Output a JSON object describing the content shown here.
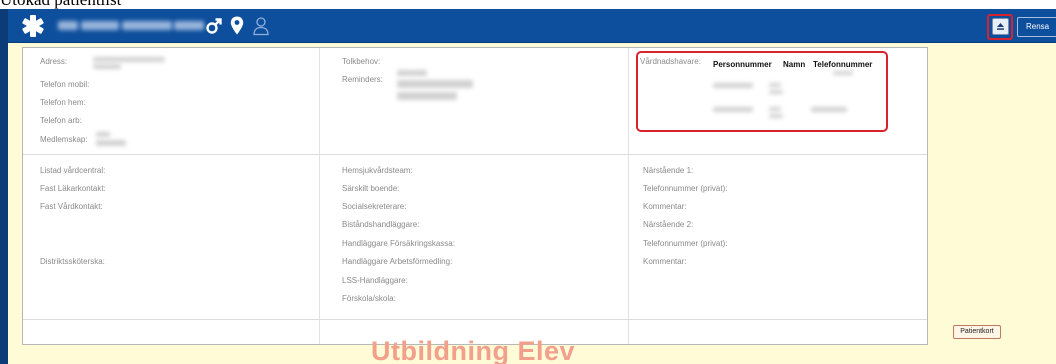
{
  "page": {
    "caption": "Utökad patientlist"
  },
  "header": {
    "patient_name_label": "",
    "collapse_icon": "eject-icon",
    "rensa_label": "Rensa",
    "icons": [
      "star-of-life-icon",
      "male-icon",
      "location-pin-icon",
      "person-icon"
    ]
  },
  "contact": {
    "adress_label": "Adress:",
    "telefon_mobil_label": "Telefon mobil:",
    "telefon_hem_label": "Telefon hem:",
    "telefon_arb_label": "Telefon arb:",
    "medlemskap_label": "Medlemskap:"
  },
  "needs": {
    "tolkbehov_label": "Tolkbehov:",
    "reminders_label": "Reminders:"
  },
  "guardian": {
    "label": "Vårdnadshavare:",
    "columns": [
      "Personnummer",
      "Namn",
      "Telefonnummer"
    ]
  },
  "care": {
    "col1": {
      "listad_label": "Listad vårdcentral:",
      "fast_lakare_label": "Fast Läkarkontakt:",
      "fast_vard_label": "Fast Vårdkontakt:",
      "distrikt_label": "Distriktssköterska:"
    },
    "col2": {
      "hemsjukvard_label": "Hemsjukvårdsteam:",
      "sarskilt_label": "Särskilt boende:",
      "social_label": "Socialsekreterare:",
      "bistand_label": "Biståndshandläggare:",
      "forsakring_label": "Handläggare Försäkringskassa:",
      "arbetsformedling_label": "Handläggare Arbetsförmedling:",
      "lss_label": "LSS-Handläggare:",
      "forskola_label": "Förskola/skola:"
    },
    "col3": {
      "narstaende1_label": "Närstående 1:",
      "telefon1_label": "Telefonnummer (privat):",
      "kommentar1_label": "Kommentar:",
      "narstaende2_label": "Närstående 2:",
      "telefon2_label": "Telefonnummer (privat):",
      "kommentar2_label": "Kommentar:"
    }
  },
  "footer": {
    "patientkort_label": "Patientkort",
    "watermark": "Utbildning Elev"
  },
  "colors": {
    "header_blue": "#0d4f9d",
    "highlight_red": "#d7232e",
    "page_yellow": "#fffbd6",
    "watermark": "#f2a08c"
  }
}
